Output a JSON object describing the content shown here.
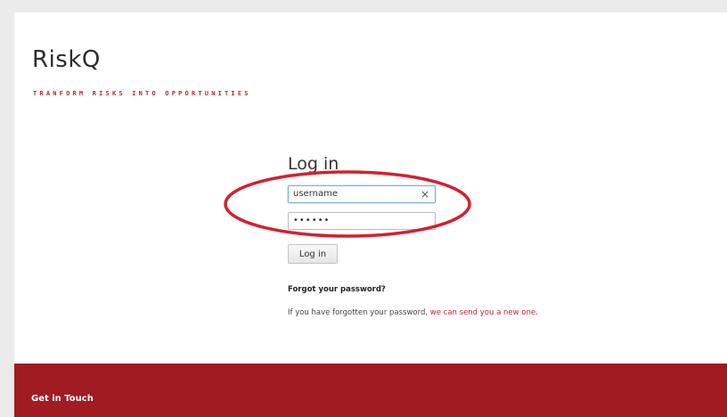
{
  "brand": {
    "title": "RiskQ",
    "tagline": "TRANFORM RISKS INTO OPPORTUNITIES"
  },
  "login": {
    "heading": "Log in",
    "username_value": "username",
    "password_value": "••••••",
    "clear_symbol": "×",
    "button_label": "Log in"
  },
  "forgot": {
    "heading": "Forgot your password?",
    "text": "If you have forgotten your password, ",
    "link_text": "we can send you a new one."
  },
  "footer": {
    "heading": "Get in Touch"
  },
  "colors": {
    "accent": "#a11b22",
    "link": "#c2272d",
    "tagline": "#b5282e",
    "annotation": "#d42030"
  }
}
